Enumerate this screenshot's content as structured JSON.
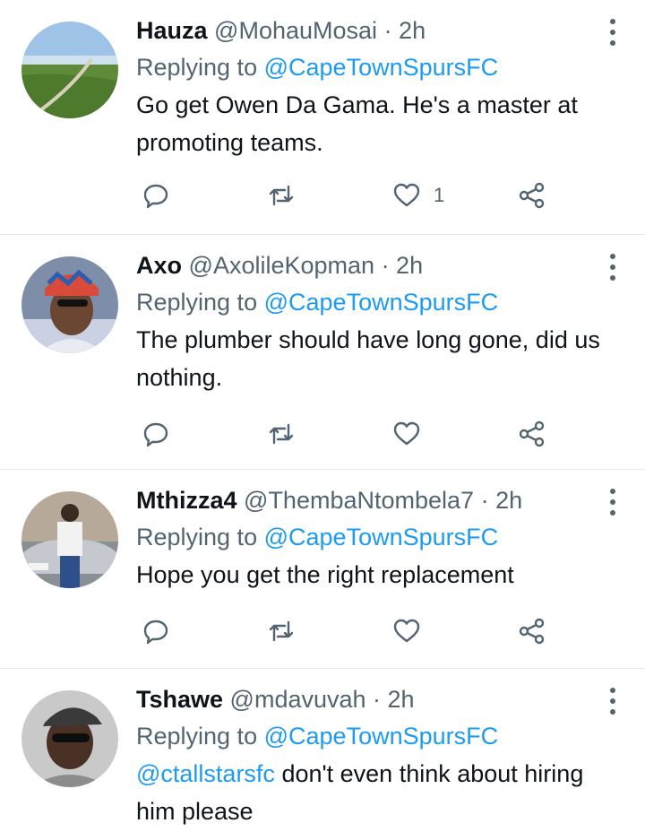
{
  "tweets": [
    {
      "name": "Hauza",
      "handle": "@MohauMosai",
      "time": "· 2h",
      "replying_prefix": "Replying to",
      "replying_to": "@CapeTownSpursFC",
      "text": "Go get Owen Da Gama. He's a master at promoting teams.",
      "like_count": "1",
      "icons": [
        "reply-icon",
        "retweet-icon",
        "like-icon",
        "share-icon"
      ]
    },
    {
      "name": "Axo",
      "handle": "@AxolileKopman",
      "time": "· 2h",
      "replying_prefix": "Replying to",
      "replying_to": "@CapeTownSpursFC",
      "text": "The plumber should have long gone, did us nothing.",
      "icons": [
        "reply-icon",
        "retweet-icon",
        "like-icon",
        "share-icon"
      ]
    },
    {
      "name": "Mthizza4",
      "handle": "@ThembaNtombela7",
      "time": "· 2h",
      "replying_prefix": "Replying to",
      "replying_to": "@CapeTownSpursFC",
      "text": "Hope you get the right replacement",
      "icons": [
        "reply-icon",
        "retweet-icon",
        "like-icon",
        "share-icon"
      ]
    },
    {
      "name": "Tshawe",
      "handle": "@mdavuvah",
      "time": "· 2h",
      "replying_prefix": "Replying to",
      "replying_to": "@CapeTownSpursFC",
      "text_mention": "@ctallstarsfc",
      "text": " don't even think about hiring him please"
    }
  ],
  "colors": {
    "link": "#1d9bf0",
    "secondary": "#536471",
    "divider": "#e3e7ea"
  }
}
